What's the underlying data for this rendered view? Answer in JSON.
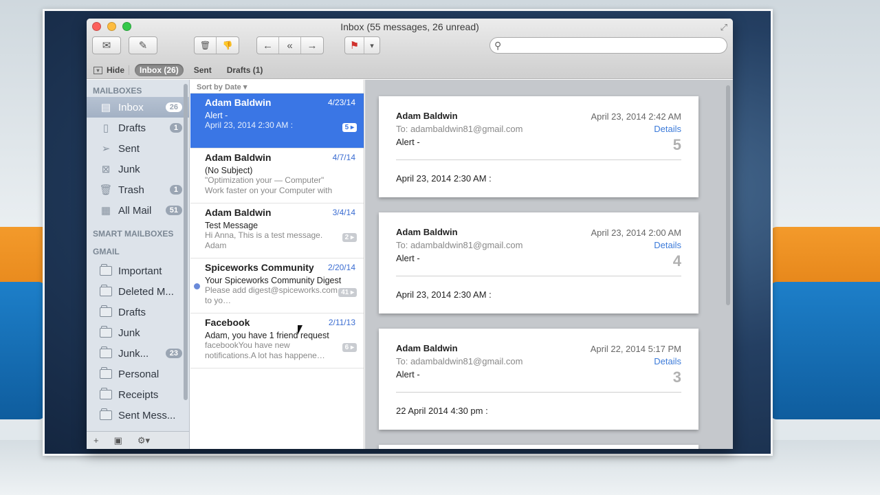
{
  "window": {
    "title": "Inbox (55 messages, 26 unread)"
  },
  "toolbar": {
    "buttons": [
      {
        "name": "get-mail",
        "icon": "envelope-icon",
        "glyph": "✉"
      },
      {
        "name": "compose",
        "icon": "compose-icon",
        "glyph": "✎"
      },
      {
        "name": "delete",
        "icon": "trash-icon",
        "glyph": "🗑"
      },
      {
        "name": "junk",
        "icon": "thumbs-down-icon",
        "glyph": "👎"
      },
      {
        "name": "reply",
        "icon": "reply-icon",
        "glyph": "←"
      },
      {
        "name": "reply-all",
        "icon": "reply-all-icon",
        "glyph": "«"
      },
      {
        "name": "forward",
        "icon": "forward-icon",
        "glyph": "→"
      },
      {
        "name": "flag",
        "icon": "flag-icon",
        "glyph": "⚑"
      },
      {
        "name": "flag-menu",
        "icon": "chevron-down-icon",
        "glyph": "▾"
      }
    ],
    "search_placeholder": ""
  },
  "favorites": {
    "hide_label": "Hide",
    "items": [
      "Inbox (26)",
      "Sent",
      "Drafts (1)"
    ]
  },
  "sidebar": {
    "mailboxes_header": "MAILBOXES",
    "mailboxes": [
      {
        "label": "Inbox",
        "badge": "26",
        "icon": "inbox-icon"
      },
      {
        "label": "Drafts",
        "badge": "1",
        "icon": "drafts-icon"
      },
      {
        "label": "Sent",
        "badge": "",
        "icon": "sent-icon"
      },
      {
        "label": "Junk",
        "badge": "",
        "icon": "junk-icon"
      },
      {
        "label": "Trash",
        "badge": "1",
        "icon": "trash-icon"
      },
      {
        "label": "All Mail",
        "badge": "51",
        "icon": "all-mail-icon"
      }
    ],
    "smart_header": "SMART MAILBOXES",
    "gmail_header": "GMAIL",
    "gmail": [
      {
        "label": "Important",
        "badge": ""
      },
      {
        "label": "Deleted M...",
        "badge": ""
      },
      {
        "label": "Drafts",
        "badge": ""
      },
      {
        "label": "Junk",
        "badge": ""
      },
      {
        "label": "Junk...",
        "badge": "23"
      },
      {
        "label": "Personal",
        "badge": ""
      },
      {
        "label": "Receipts",
        "badge": ""
      },
      {
        "label": "Sent Mess...",
        "badge": ""
      }
    ],
    "footer": {
      "add": "+",
      "photo": "▣",
      "gear": "⚙▾"
    }
  },
  "list": {
    "sort_label": "Sort by Date ▾",
    "messages": [
      {
        "from": "Adam Baldwin",
        "date": "4/23/14",
        "subject": "Alert -",
        "preview": "April 23, 2014 2:30 AM :",
        "count": "5 ▸",
        "unread": false
      },
      {
        "from": "Adam Baldwin",
        "date": "4/7/14",
        "subject": "(No Subject)",
        "preview": "\"Optimization your — Computer\" Work faster on your Computer with suppo…",
        "count": "",
        "unread": false
      },
      {
        "from": "Adam Baldwin",
        "date": "3/4/14",
        "subject": "Test Message",
        "preview": "Hi Anna, This is a test message. Adam",
        "count": "2 ▸",
        "unread": false
      },
      {
        "from": "Spiceworks Community",
        "date": "2/20/14",
        "subject": "Your Spiceworks Community Digest",
        "preview": "Please add digest@spiceworks.com to yo…",
        "count": "41 ▸",
        "unread": true
      },
      {
        "from": "Facebook",
        "date": "2/11/13",
        "subject": "Adam, you have 1 friend request",
        "preview": "facebookYou have new notifications.A lot has happene…",
        "count": "6 ▸",
        "unread": false
      }
    ]
  },
  "reader": {
    "cards": [
      {
        "from": "Adam Baldwin",
        "date": "April 23, 2014  2:42 AM",
        "to": "To: adambaldwin81@gmail.com",
        "details": "Details",
        "subject": "Alert -",
        "num": "5",
        "body": "April 23, 2014 2:30 AM :"
      },
      {
        "from": "Adam Baldwin",
        "date": "April 23, 2014  2:00 AM",
        "to": "To: adambaldwin81@gmail.com",
        "details": "Details",
        "subject": "Alert -",
        "num": "4",
        "body": "April 23, 2014 2:30 AM :"
      },
      {
        "from": "Adam Baldwin",
        "date": "April 22, 2014  5:17 PM",
        "to": "To: adambaldwin81@gmail.com",
        "details": "Details",
        "subject": "Alert -",
        "num": "3",
        "body": "22 April 2014 4:30 pm :"
      }
    ]
  },
  "colors": {
    "selection": "#3a76e5",
    "link": "#3b7ad9",
    "sidebar": "#dde3ea"
  }
}
